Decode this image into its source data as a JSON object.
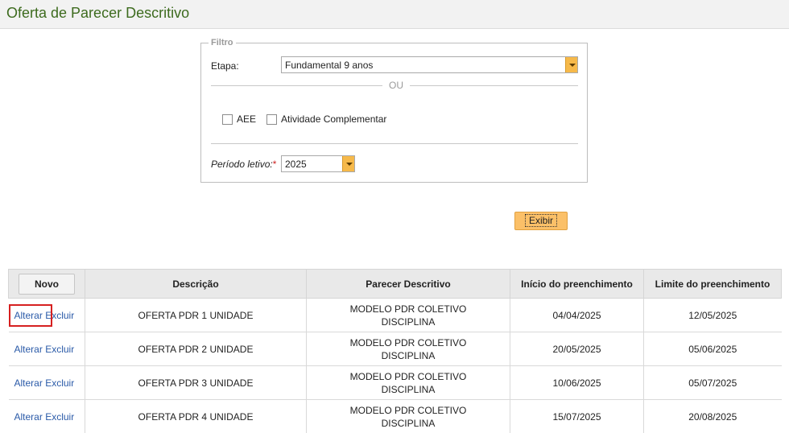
{
  "page": {
    "title": "Oferta de Parecer Descritivo"
  },
  "filter": {
    "legend": "Filtro",
    "etapa_label": "Etapa:",
    "etapa_value": "Fundamental 9 anos",
    "or_label": "OU",
    "aee_label": "AEE",
    "atividade_label": "Atividade Complementar",
    "periodo_label": "Período letivo:",
    "periodo_required": "*",
    "periodo_value": "2025"
  },
  "exibir_button": "Exibir",
  "table": {
    "novo_button": "Novo",
    "headers": [
      "Descrição",
      "Parecer Descritivo",
      "Início do preenchimento",
      "Limite do preenchimento"
    ],
    "alterar_label": "Alterar",
    "excluir_label": "Excluir",
    "rows": [
      {
        "descricao": "OFERTA PDR 1 UNIDADE",
        "parecer_line1": "MODELO PDR COLETIVO",
        "parecer_line2": "DISCIPLINA",
        "inicio": "04/04/2025",
        "limite": "12/05/2025"
      },
      {
        "descricao": "OFERTA PDR 2 UNIDADE",
        "parecer_line1": "MODELO PDR COLETIVO",
        "parecer_line2": "DISCIPLINA",
        "inicio": "20/05/2025",
        "limite": "05/06/2025"
      },
      {
        "descricao": "OFERTA PDR 3 UNIDADE",
        "parecer_line1": "MODELO PDR COLETIVO",
        "parecer_line2": "DISCIPLINA",
        "inicio": "10/06/2025",
        "limite": "05/07/2025"
      },
      {
        "descricao": "OFERTA PDR 4 UNIDADE",
        "parecer_line1": "MODELO PDR COLETIVO",
        "parecer_line2": "DISCIPLINA",
        "inicio": "15/07/2025",
        "limite": "20/08/2025"
      }
    ]
  },
  "colors": {
    "title_green": "#3d6b1e",
    "link_blue": "#2a5aa8",
    "button_orange": "#fbc068",
    "highlight_red": "#d62020"
  }
}
